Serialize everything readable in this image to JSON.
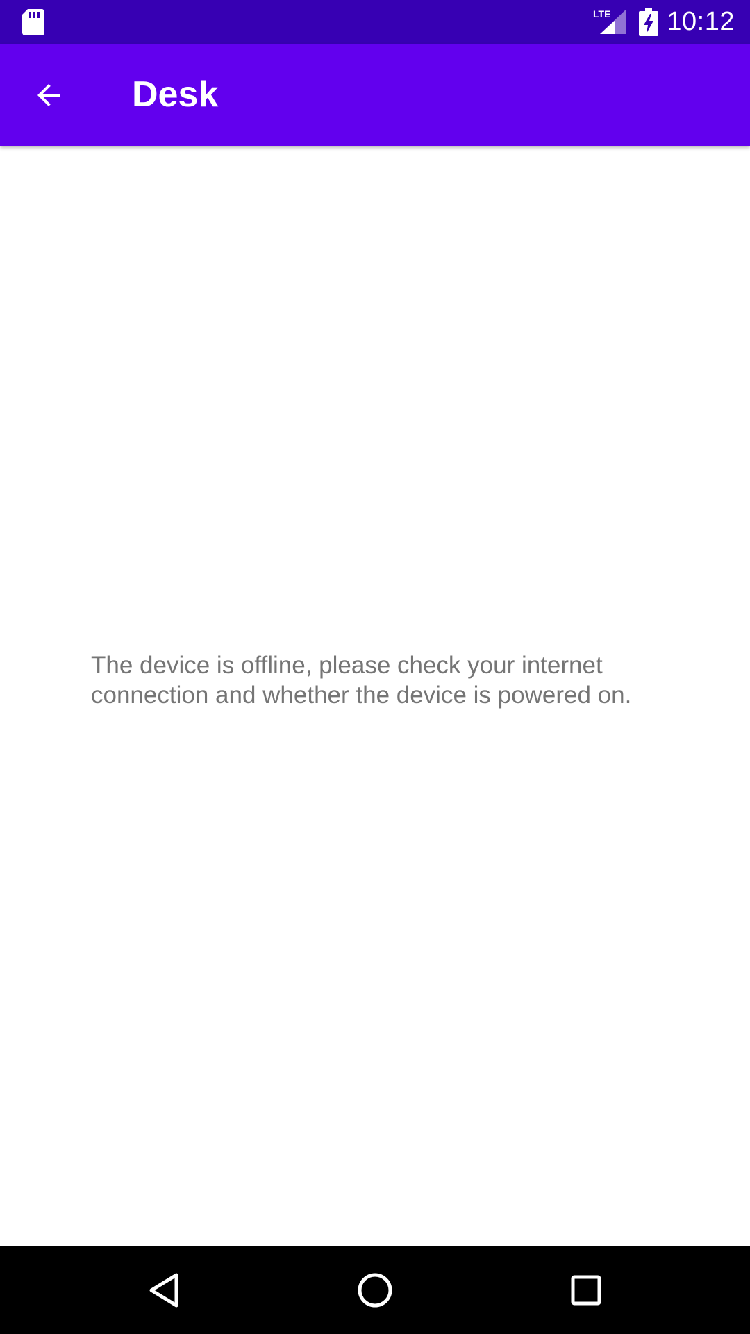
{
  "status_bar": {
    "time": "10:12",
    "network_label": "LTE",
    "icons": [
      "sd-card-icon",
      "lte-signal-icon",
      "battery-charging-icon"
    ]
  },
  "app_bar": {
    "title": "Desk",
    "back_icon": "arrow-back-icon",
    "color": "#6200ee"
  },
  "content": {
    "message": "The device is offline, please check your internet connection and whether the device is powered on."
  },
  "nav_bar": {
    "buttons": [
      "back-triangle-icon",
      "home-circle-icon",
      "recents-square-icon"
    ]
  },
  "colors": {
    "status_bar": "#3700b3",
    "app_bar": "#6200ee",
    "message_text": "#757575",
    "nav_bar": "#000000"
  }
}
